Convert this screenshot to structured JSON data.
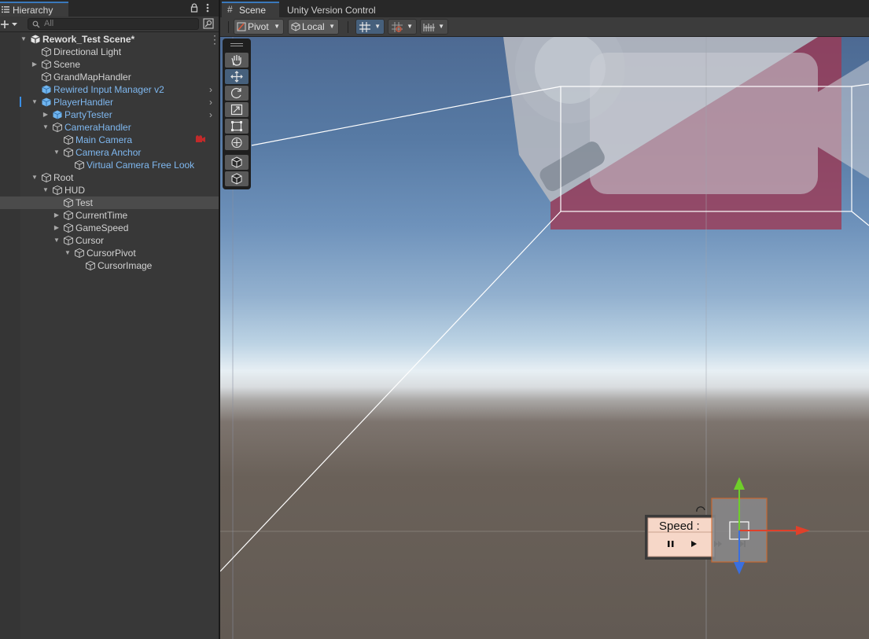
{
  "hierarchy": {
    "tab_label": "Hierarchy",
    "search_placeholder": "All",
    "rows": [
      {
        "label": "Rework_Test Scene*",
        "depth": 0,
        "arrow": "down",
        "icon": "unity-scene-icon",
        "style": "bold"
      },
      {
        "label": "Directional Light",
        "depth": 1,
        "arrow": "",
        "icon": "gameobject-cube-icon",
        "style": "normal"
      },
      {
        "label": "Scene",
        "depth": 1,
        "arrow": "right",
        "icon": "gameobject-cube-icon",
        "style": "normal"
      },
      {
        "label": "GrandMapHandler",
        "depth": 1,
        "arrow": "",
        "icon": "gameobject-cube-icon",
        "style": "normal"
      },
      {
        "label": "Rewired Input Manager v2",
        "depth": 1,
        "arrow": "",
        "icon": "prefab-cube-icon",
        "style": "prefab",
        "chevron": true
      },
      {
        "label": "PlayerHandler",
        "depth": 1,
        "arrow": "down",
        "icon": "prefab-cube-icon",
        "style": "prefab",
        "chevron": true
      },
      {
        "label": "PartyTester",
        "depth": 2,
        "arrow": "right",
        "icon": "prefab-cube-icon",
        "style": "prefab",
        "chevron": true
      },
      {
        "label": "CameraHandler",
        "depth": 2,
        "arrow": "down",
        "icon": "gameobject-cube-icon",
        "style": "prefab"
      },
      {
        "label": "Main Camera",
        "depth": 3,
        "arrow": "",
        "icon": "gameobject-cube-icon",
        "style": "prefab"
      },
      {
        "label": "Camera Anchor",
        "depth": 3,
        "arrow": "down",
        "icon": "gameobject-cube-icon",
        "style": "prefab"
      },
      {
        "label": "Virtual Camera Free Look",
        "depth": 4,
        "arrow": "",
        "icon": "gameobject-cube-icon",
        "style": "prefab"
      },
      {
        "label": "Root",
        "depth": 1,
        "arrow": "down",
        "icon": "gameobject-cube-icon",
        "style": "normal"
      },
      {
        "label": "HUD",
        "depth": 2,
        "arrow": "down",
        "icon": "gameobject-cube-icon",
        "style": "normal"
      },
      {
        "label": "Test",
        "depth": 3,
        "arrow": "",
        "icon": "gameobject-cube-icon",
        "style": "normal",
        "selected": true
      },
      {
        "label": "CurrentTime",
        "depth": 3,
        "arrow": "right",
        "icon": "gameobject-cube-icon",
        "style": "normal"
      },
      {
        "label": "GameSpeed",
        "depth": 3,
        "arrow": "right",
        "icon": "gameobject-cube-icon",
        "style": "normal"
      },
      {
        "label": "Cursor",
        "depth": 3,
        "arrow": "down",
        "icon": "gameobject-cube-icon",
        "style": "normal"
      },
      {
        "label": "CursorPivot",
        "depth": 4,
        "arrow": "down",
        "icon": "gameobject-cube-icon",
        "style": "normal"
      },
      {
        "label": "CursorImage",
        "depth": 5,
        "arrow": "",
        "icon": "gameobject-cube-icon",
        "style": "normal"
      }
    ]
  },
  "scene": {
    "tab_scene": "Scene",
    "tab_uvc": "Unity Version Control",
    "pivot_label": "Pivot",
    "local_label": "Local",
    "speed_label": "Speed :"
  },
  "colors": {
    "accent": "#3a79bb",
    "prefab_text": "#7fb8f0",
    "gizmo_x": "#e0402a",
    "gizmo_y": "#6fce2a",
    "gizmo_z": "#3a6fe0",
    "camera_gizmo": "#a0344e"
  }
}
